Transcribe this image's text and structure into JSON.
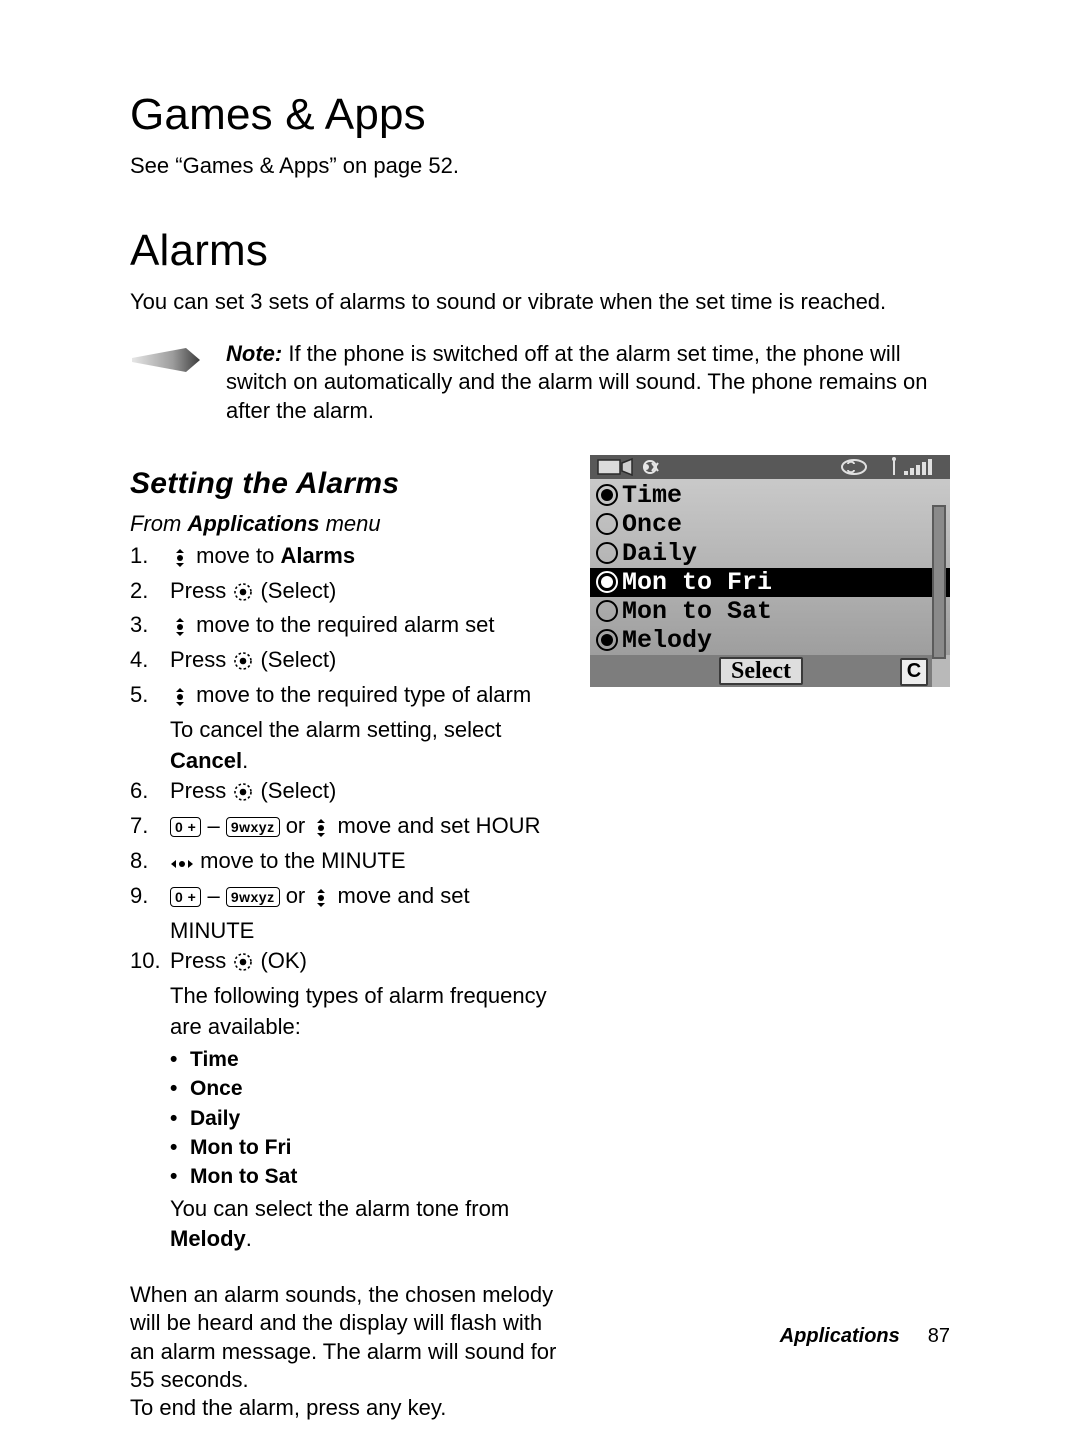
{
  "h1a": "Games & Apps",
  "p_games": "See “Games & Apps” on page 52.",
  "h1b": "Alarms",
  "p_alarms": "You can set 3 sets of alarms to sound or vibrate when the set time is reached.",
  "note_lead": "Note:",
  "note_body": " If the phone is switched off at the alarm set time, the phone will switch on automatically and the alarm will sound. The phone remains on after the alarm.",
  "h2": "Setting the Alarms",
  "from_pre": "From ",
  "from_b": "Applications",
  "from_post": " menu",
  "steps": {
    "s1a": " move to ",
    "s1b": "Alarms",
    "s2a": "Press ",
    "s2b": " (Select)",
    "s3": " move to the required alarm set",
    "s4a": "Press ",
    "s4b": " (Select)",
    "s5": " move to the required type of alarm",
    "s5c_a": "To cancel the alarm setting, select ",
    "s5c_b": "Cancel",
    "s5c_c": ".",
    "s6a": "Press ",
    "s6b": " (Select)",
    "s7_mid": " or ",
    "s7_end": " move and set HOUR",
    "s8": " move to the MINUTE",
    "s9_mid": " or ",
    "s9_end": " move and set MINUTE",
    "s10a": "Press ",
    "s10b": " (OK)"
  },
  "after_list": "The following types of alarm frequency are available:",
  "freq": [
    "Time",
    "Once",
    "Daily",
    "Mon to Fri",
    "Mon to Sat"
  ],
  "melody_a": "You can select the alarm tone from ",
  "melody_b": "Melody",
  "melody_c": ".",
  "para2": "When an alarm sounds, the chosen melody will be heard and the display will flash with an alarm message. The alarm will sound for 55 seconds.\nTo end the alarm, press any key.",
  "key0": "0 +",
  "key9": "9wxyz",
  "dash": " – ",
  "phone": {
    "items": [
      {
        "label": "Time",
        "filled": true,
        "hl": false
      },
      {
        "label": "Once",
        "filled": false,
        "hl": false
      },
      {
        "label": "Daily",
        "filled": false,
        "hl": false
      },
      {
        "label": "Mon to Fri",
        "filled": true,
        "hl": true
      },
      {
        "label": "Mon to Sat",
        "filled": false,
        "hl": false
      },
      {
        "label": "Melody",
        "filled": true,
        "hl": false
      }
    ],
    "select": "Select",
    "c": "C"
  },
  "footer_section": "Applications",
  "footer_page": "87"
}
